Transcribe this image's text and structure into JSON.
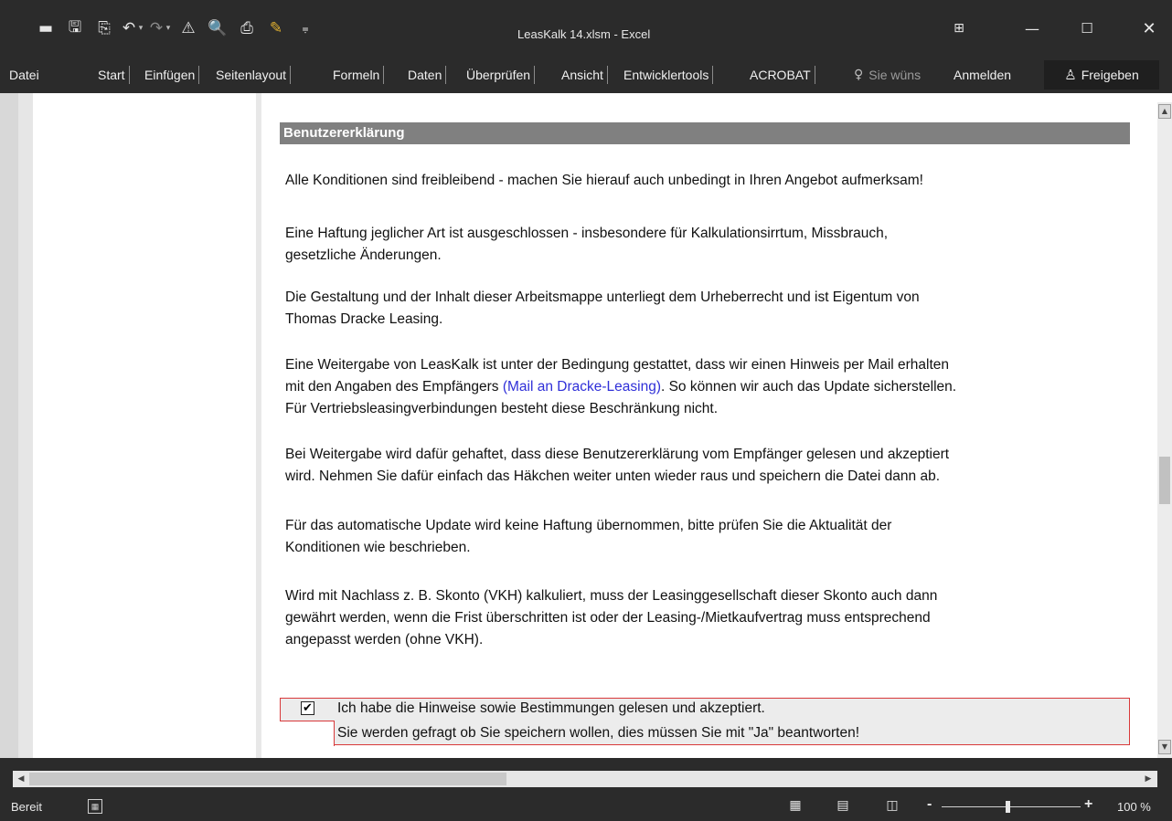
{
  "window": {
    "title": "LeasKalk 14.xlsm - Excel",
    "controls": [
      "ribbon-display-icon",
      "minimize-icon",
      "maximize-icon",
      "close-icon"
    ]
  },
  "quick_access": [
    "new-file-icon",
    "save-icon",
    "save-as-icon",
    "undo-icon",
    "redo-icon",
    "macro-security-icon",
    "print-preview-icon",
    "print-icon",
    "highlighter-icon",
    "customize-qat-icon"
  ],
  "ribbon": {
    "tabs": [
      "Datei",
      "Start",
      "Einfügen",
      "Seitenlayout",
      "Formeln",
      "Daten",
      "Überprüfen",
      "Ansicht",
      "Entwicklertools",
      "ACROBAT"
    ],
    "tell_me": "Sie wüns",
    "sign_in": "Anmelden",
    "share": "Freigeben"
  },
  "sheet": {
    "header": "Benutzererklärung",
    "paragraphs": {
      "p1": "Alle Konditionen sind freibleibend - machen Sie hierauf auch unbedingt in Ihren Angebot aufmerksam!",
      "p2a": "Eine Haftung jeglicher Art ist ausgeschlossen - insbesondere für Kalkulationsirrtum, Missbrauch,",
      "p2b": "gesetzliche Änderungen.",
      "p3a": "Die Gestaltung und der Inhalt dieser Arbeitsmappe unterliegt dem Urheberrecht und ist Eigentum von",
      "p3b": "Thomas Dracke Leasing.",
      "p4a": "Eine Weitergabe von LeasKalk ist unter der Bedingung gestattet, dass wir einen Hinweis per Mail erhalten",
      "p4b_pre": "mit den Angaben des Empfängers ",
      "p4b_link": "(Mail an Dracke-Leasing)",
      "p4b_post": ". So können wir auch das Update sicherstellen.",
      "p4c": "Für Vertriebsleasingverbindungen besteht diese Beschränkung nicht.",
      "p5a": "Bei Weitergabe wird dafür gehaftet, dass diese Benutzererklärung vom Empfänger gelesen und akzeptiert",
      "p5b": "wird. Nehmen Sie dafür einfach das Häkchen weiter unten wieder raus und speichern die Datei dann ab.",
      "p6a": "Für das automatische Update wird keine Haftung übernommen, bitte prüfen Sie die Aktualität der",
      "p6b": "Konditionen wie beschrieben.",
      "p7a": "Wird mit Nachlass z. B. Skonto (VKH) kalkuliert, muss der Leasinggesellschaft dieser Skonto auch dann",
      "p7b": "gewährt werden, wenn die Frist überschritten ist oder der Leasing-/Mietkaufvertrag muss entsprechend",
      "p7c": "angepasst werden (ohne VKH)."
    },
    "confirm": {
      "checked": true,
      "line1": "Ich habe die Hinweise sowie Bestimmungen gelesen und akzeptiert.",
      "line2": "Sie werden gefragt ob Sie speichern wollen, dies müssen Sie mit \"Ja\" beantworten!"
    }
  },
  "status": {
    "ready": "Bereit",
    "zoom": "100 %",
    "zoom_minus": "-",
    "zoom_plus": "+"
  },
  "colors": {
    "chrome": "#2b2b2b",
    "header_bar": "#808080",
    "link": "#2f2fd8",
    "confirm_border": "#d8393a"
  }
}
